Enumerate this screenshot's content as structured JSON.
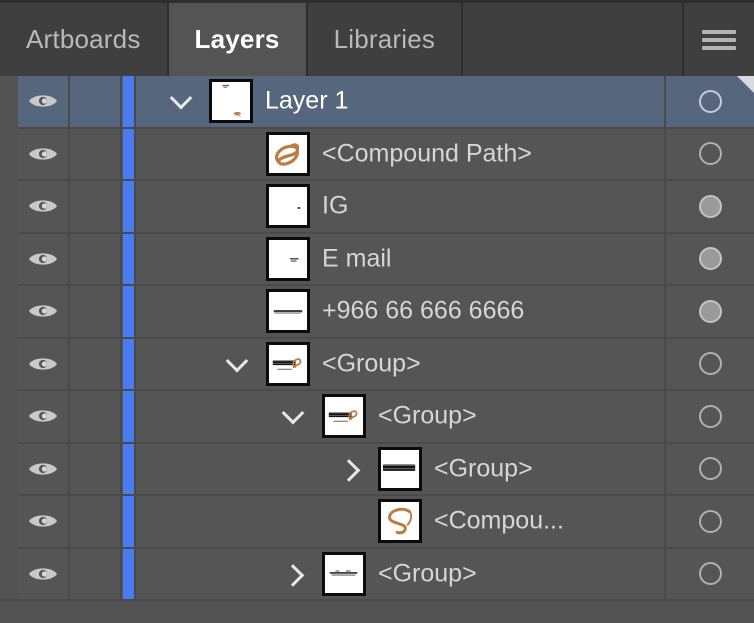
{
  "panel": {
    "title": "Layers",
    "menu_icon": "hamburger-menu-icon"
  },
  "tabs": [
    {
      "label": "Artboards",
      "active": false
    },
    {
      "label": "Layers",
      "active": true
    },
    {
      "label": "Libraries",
      "active": false
    }
  ],
  "columns": {
    "visibility": "eye-icon",
    "lock": "lock-column",
    "color_strip": "#4a7bf0",
    "target": "target-circle"
  },
  "colors": {
    "panel_bg": "#535353",
    "row_bg": "#555555",
    "row_selected_bg": "#56667c",
    "tab_bg": "#3f3f3f",
    "tab_active_bg": "#545454",
    "row_divider": "#4a4a4a",
    "layer_color": "#4a7bf0",
    "text": "#d6d6d6",
    "text_selected": "#ffffff",
    "thumb_art": "#bf7b44"
  },
  "rows": [
    {
      "label": "Layer 1",
      "indent": 0,
      "visible": true,
      "selected": true,
      "disclosure": "down",
      "target_filled": false,
      "thumb": "layer1",
      "corner_marker": true
    },
    {
      "label": "<Compound Path>",
      "indent": 1,
      "visible": true,
      "selected": false,
      "disclosure": "none",
      "target_filled": false,
      "thumb": "swirl",
      "corner_marker": false
    },
    {
      "label": "IG",
      "indent": 1,
      "visible": true,
      "selected": false,
      "disclosure": "none",
      "target_filled": true,
      "thumb": "blank-dot",
      "corner_marker": false
    },
    {
      "label": "E mail",
      "indent": 1,
      "visible": true,
      "selected": false,
      "disclosure": "none",
      "target_filled": true,
      "thumb": "tiny-text",
      "corner_marker": false
    },
    {
      "label": "+966 66 666 6666",
      "indent": 1,
      "visible": true,
      "selected": false,
      "disclosure": "none",
      "target_filled": true,
      "thumb": "phone-text",
      "corner_marker": false
    },
    {
      "label": "<Group>",
      "indent": 1,
      "visible": true,
      "selected": false,
      "disclosure": "down",
      "target_filled": false,
      "thumb": "seeby-full",
      "corner_marker": false
    },
    {
      "label": "<Group>",
      "indent": 2,
      "visible": true,
      "selected": false,
      "disclosure": "down",
      "target_filled": false,
      "thumb": "seeby-full",
      "corner_marker": false
    },
    {
      "label": "<Group>",
      "indent": 3,
      "visible": true,
      "selected": false,
      "disclosure": "right",
      "target_filled": false,
      "thumb": "seeby-word",
      "corner_marker": false
    },
    {
      "label": "<Compou...",
      "indent": 4,
      "visible": true,
      "selected": false,
      "disclosure": "none",
      "target_filled": false,
      "thumb": "big-swirl",
      "corner_marker": false
    },
    {
      "label": "<Group>",
      "indent": 2,
      "visible": true,
      "selected": false,
      "disclosure": "right",
      "target_filled": false,
      "thumb": "arabic-text",
      "corner_marker": false
    }
  ]
}
